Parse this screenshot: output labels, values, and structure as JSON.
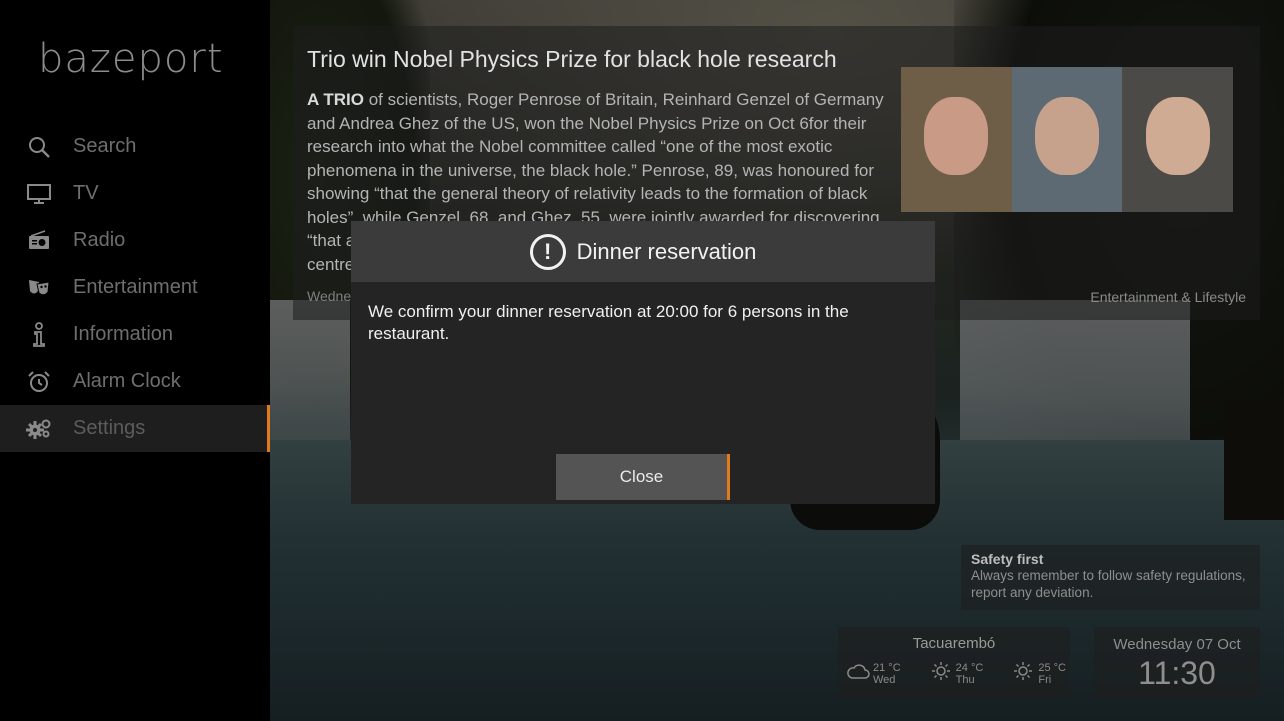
{
  "brand": {
    "logo": "bazeport"
  },
  "sidebar": {
    "items": [
      {
        "label": "Search",
        "icon": "search-icon"
      },
      {
        "label": "TV",
        "icon": "tv-icon"
      },
      {
        "label": "Radio",
        "icon": "radio-icon"
      },
      {
        "label": "Entertainment",
        "icon": "theater-masks-icon"
      },
      {
        "label": "Information",
        "icon": "info-icon"
      },
      {
        "label": "Alarm Clock",
        "icon": "alarm-clock-icon"
      },
      {
        "label": "Settings",
        "icon": "gears-icon",
        "active": true
      }
    ]
  },
  "news": {
    "title": "Trio win Nobel Physics Prize for black hole research",
    "lead": "A TRIO",
    "body": "of scientists, Roger Penrose of Britain, Reinhard Genzel of Germany and Andrea Ghez of the US, won the Nobel Physics Prize on Oct 6for their research into what the Nobel committee called “one of the most exotic phenomena in the universe, the black hole.” Penrose, 89, was honoured for showing “that the general theory of relativity leads to the formation of black holes”, while Genzel, 68, and Ghez, 55, were jointly awarded for discovering “that an invisible and extremely heavy object governs the orbits of stars at the centre o...",
    "date": "Wednesday 7 October 2020 06:04:21 CEST",
    "category": "Entertainment & Lifestyle"
  },
  "safety": {
    "title": "Safety first",
    "text": "Always remember to follow safety regulations, report any deviation."
  },
  "weather": {
    "city": "Tacuarembó",
    "days": [
      {
        "temp": "21 °C",
        "day": "Wed",
        "icon": "cloud-icon"
      },
      {
        "temp": "24 °C",
        "day": "Thu",
        "icon": "sun-icon"
      },
      {
        "temp": "25 °C",
        "day": "Fri",
        "icon": "sun-icon"
      }
    ]
  },
  "clock": {
    "date": "Wednesday 07 Oct",
    "time": "11:30"
  },
  "modal": {
    "title": "Dinner reservation",
    "message": "We confirm your dinner reservation at 20:00 for 6 persons in the restaurant.",
    "close_label": "Close"
  },
  "colors": {
    "accent": "#e07a1b",
    "modal_bg": "#242424",
    "modal_header": "#3b3b3b"
  }
}
